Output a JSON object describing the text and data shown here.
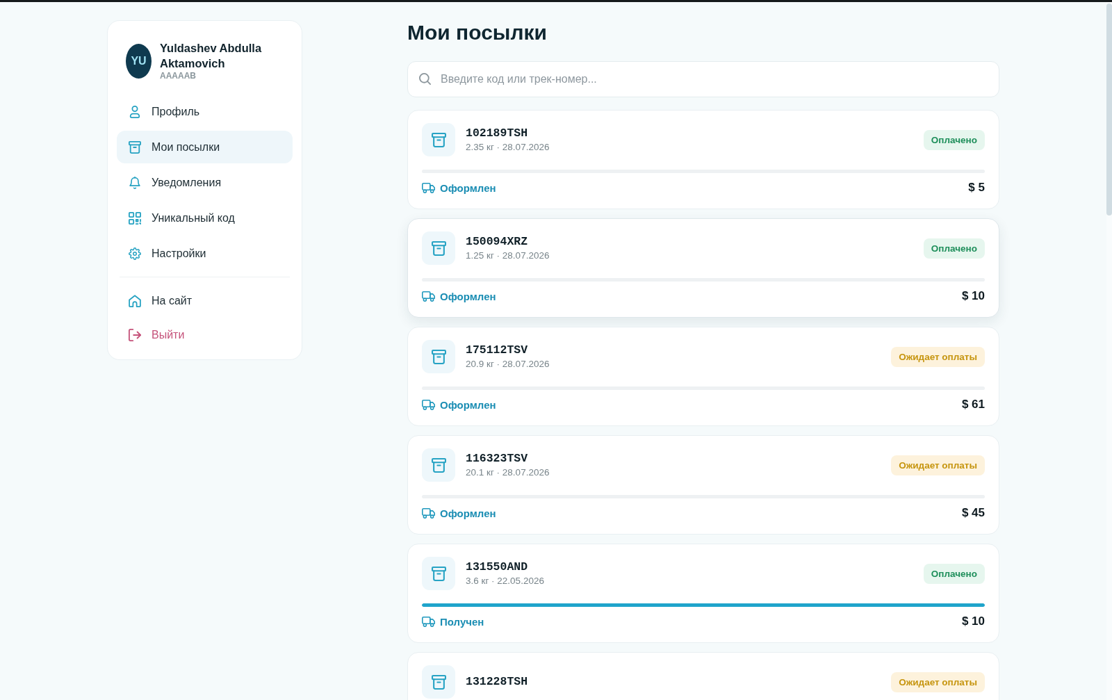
{
  "sidebar": {
    "user": {
      "initials": "YU",
      "name": "Yuldashev Abdulla Aktamovich",
      "code": "AAAAAB"
    },
    "items": [
      {
        "label": "Профиль",
        "selected": false
      },
      {
        "label": "Мои посылки",
        "selected": true
      },
      {
        "label": "Уведомления",
        "selected": false
      },
      {
        "label": "Уникальный код",
        "selected": false
      },
      {
        "label": "Настройки",
        "selected": false
      }
    ],
    "links": [
      {
        "label": "На сайт",
        "kind": "normal"
      },
      {
        "label": "Выйти",
        "kind": "danger"
      }
    ]
  },
  "main": {
    "title": "Мои посылки",
    "search": {
      "placeholder": "Введите код или трек-номер..."
    },
    "parcels": [
      {
        "code": "102189TSH",
        "meta": "2.35 кг · 28.07.2026",
        "payment": {
          "text": "Оплачено",
          "kind": "paid"
        },
        "level": 0,
        "delivery": "Оформлен",
        "price": "$ 5",
        "highlighted": false
      },
      {
        "code": "150094XRZ",
        "meta": "1.25 кг · 28.07.2026",
        "payment": {
          "text": "Оплачено",
          "kind": "paid"
        },
        "level": 0,
        "delivery": "Оформлен",
        "price": "$ 10",
        "highlighted": true
      },
      {
        "code": "175112TSV",
        "meta": "20.9 кг · 28.07.2026",
        "payment": {
          "text": "Ожидает оплаты",
          "kind": "pending"
        },
        "level": 0,
        "delivery": "Оформлен",
        "price": "$ 61",
        "highlighted": false
      },
      {
        "code": "116323TSV",
        "meta": "20.1 кг · 28.07.2026",
        "payment": {
          "text": "Ожидает оплаты",
          "kind": "pending"
        },
        "level": 0,
        "delivery": "Оформлен",
        "price": "$ 45",
        "highlighted": false
      },
      {
        "code": "131550AND",
        "meta": "3.6 кг · 22.05.2026",
        "payment": {
          "text": "Оплачено",
          "kind": "paid"
        },
        "level": 1,
        "delivery": "Получен",
        "price": "$ 10",
        "highlighted": false
      },
      {
        "code": "131228TSH",
        "payment": {
          "text": "Ожидает оплаты",
          "kind": "pending"
        }
      }
    ]
  }
}
